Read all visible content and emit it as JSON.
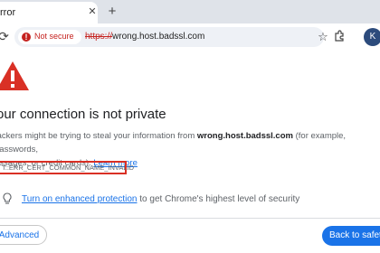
{
  "tab": {
    "title": "rror",
    "close_glyph": "✕",
    "new_tab_glyph": "+"
  },
  "toolbar": {
    "reload_icon": "reload-icon",
    "security_chip": "Not secure",
    "url_scheme": "https://",
    "url_host": "wrong.host.badssl.com",
    "star_icon": "star-icon",
    "extensions_icon": "extensions-icon",
    "avatar_letter": "K"
  },
  "page": {
    "heading": "our connection is not private",
    "para_start": "tackers might be trying to steal your information from ",
    "para_host": "wrong.host.badssl.com",
    "para_mid": " (for example, passwords,",
    "para_line2": "essages, or credit cards). ",
    "learn_more": "Learn more",
    "error_code": "T::ERR_CERT_COMMON_NAME_INVALID",
    "protection_link": "Turn on enhanced protection",
    "protection_text": " to get Chrome's highest level of security",
    "advanced_label": "Advanced",
    "back_label": "Back to safety"
  },
  "colors": {
    "danger": "#c5221f",
    "link": "#1a73e8",
    "tabstrip": "#dfe3e9",
    "omnibox": "#eef1f6"
  }
}
